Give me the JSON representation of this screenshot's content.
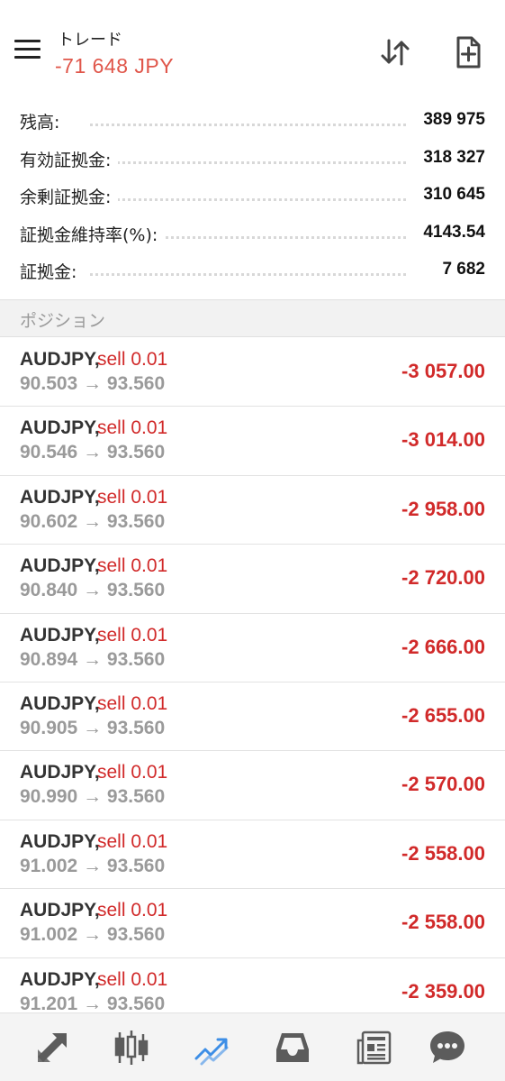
{
  "header": {
    "title": "トレード",
    "profit": "-71 648 JPY"
  },
  "summary": [
    {
      "label": "残高:",
      "value": "389 975"
    },
    {
      "label": "有効証拠金:",
      "value": "318 327"
    },
    {
      "label": "余剰証拠金:",
      "value": "310 645"
    },
    {
      "label": "証拠金維持率(%):",
      "value": "4143.54"
    },
    {
      "label": "証拠金:",
      "value": "7 682"
    }
  ],
  "section_title": "ポジション",
  "positions": [
    {
      "symbol": "AUDJPY,",
      "side": "sell 0.01",
      "prices": "90.503 → 93.560",
      "profit": "-3 057.00"
    },
    {
      "symbol": "AUDJPY,",
      "side": "sell 0.01",
      "prices": "90.546 → 93.560",
      "profit": "-3 014.00"
    },
    {
      "symbol": "AUDJPY,",
      "side": "sell 0.01",
      "prices": "90.602 → 93.560",
      "profit": "-2 958.00"
    },
    {
      "symbol": "AUDJPY,",
      "side": "sell 0.01",
      "prices": "90.840 → 93.560",
      "profit": "-2 720.00"
    },
    {
      "symbol": "AUDJPY,",
      "side": "sell 0.01",
      "prices": "90.894 → 93.560",
      "profit": "-2 666.00"
    },
    {
      "symbol": "AUDJPY,",
      "side": "sell 0.01",
      "prices": "90.905 → 93.560",
      "profit": "-2 655.00"
    },
    {
      "symbol": "AUDJPY,",
      "side": "sell 0.01",
      "prices": "90.990 → 93.560",
      "profit": "-2 570.00"
    },
    {
      "symbol": "AUDJPY,",
      "side": "sell 0.01",
      "prices": "91.002 → 93.560",
      "profit": "-2 558.00"
    },
    {
      "symbol": "AUDJPY,",
      "side": "sell 0.01",
      "prices": "91.002 → 93.560",
      "profit": "-2 558.00"
    },
    {
      "symbol": "AUDJPY,",
      "side": "sell 0.01",
      "prices": "91.201 → 93.560",
      "profit": "-2 359.00"
    }
  ],
  "nav": [
    {
      "icon": "quotes-icon",
      "active": false
    },
    {
      "icon": "chart-icon",
      "active": false
    },
    {
      "icon": "trade-icon",
      "active": true
    },
    {
      "icon": "history-icon",
      "active": false
    },
    {
      "icon": "news-icon",
      "active": false
    },
    {
      "icon": "chat-icon",
      "active": false
    }
  ],
  "colors": {
    "loss": "#d12a2a",
    "header_profit": "#e0564a",
    "active_nav": "#3d8ee6",
    "inactive_nav": "#5c5c5c"
  }
}
